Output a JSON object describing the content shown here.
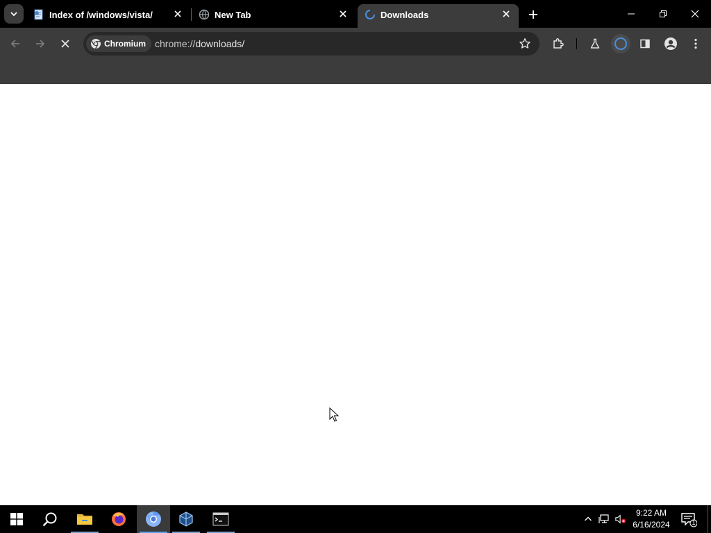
{
  "tabs": [
    {
      "title": "Index of /windows/vista/",
      "icon": "document-page-icon",
      "active": false
    },
    {
      "title": "New Tab",
      "icon": "globe-icon",
      "active": false
    },
    {
      "title": "Downloads",
      "icon": "loading-spinner-icon",
      "active": true
    }
  ],
  "omnibox": {
    "chip_label": "Chromium",
    "url_scheme": "chrome://",
    "url_path": "downloads/"
  },
  "taskbar": {
    "apps": [
      "start-icon",
      "search-icon",
      "file-explorer-icon",
      "firefox-icon",
      "chromium-icon",
      "virtualbox-icon",
      "terminal-icon"
    ],
    "clock_time": "9:22 AM",
    "clock_date": "6/16/2024",
    "notification_count": "1"
  },
  "colors": {
    "titlebar": "#000000",
    "toolbar": "#3c3c3c",
    "omnibox": "#282828",
    "accent": "#4a90e2"
  }
}
